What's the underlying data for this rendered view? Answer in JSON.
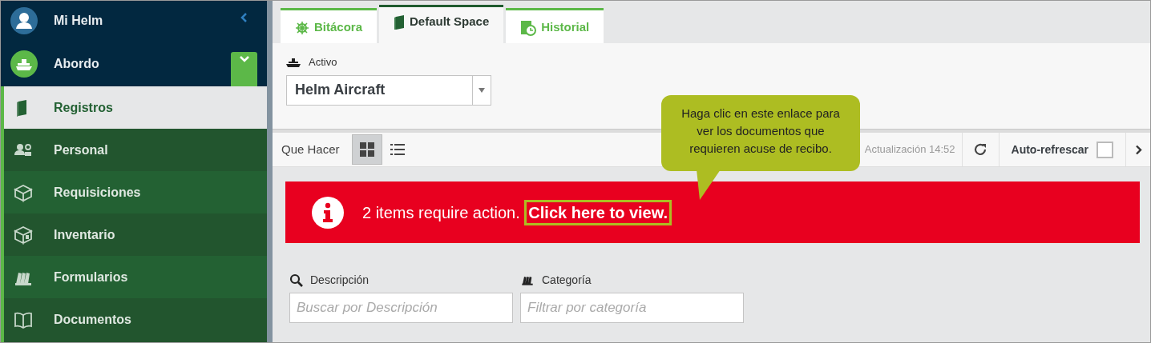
{
  "sidebar": {
    "user": {
      "label": "Mi Helm"
    },
    "section": {
      "label": "Abordo",
      "expanded": true
    },
    "items": [
      {
        "label": "Registros",
        "selected": true
      },
      {
        "label": "Personal",
        "selected": false
      },
      {
        "label": "Requisiciones",
        "selected": false
      },
      {
        "label": "Inventario",
        "selected": false
      },
      {
        "label": "Formularios",
        "selected": false
      },
      {
        "label": "Documentos",
        "selected": false
      }
    ]
  },
  "tabs": [
    {
      "label": "Bitácora",
      "selected": false
    },
    {
      "label": "Default Space",
      "selected": true
    },
    {
      "label": "Historial",
      "selected": false
    }
  ],
  "asset": {
    "label": "Activo",
    "value": "Helm Aircraft"
  },
  "toolbar": {
    "title": "Que Hacer",
    "views": [
      {
        "kind": "grid",
        "selected": true
      },
      {
        "kind": "list",
        "selected": false
      }
    ],
    "updated": "Actualización 14:52",
    "auto_refresh": {
      "label": "Auto-refrescar",
      "checked": false
    }
  },
  "alert": {
    "message": "2 items require action.",
    "link": "Click here to view."
  },
  "filters": [
    {
      "label": "Descripción",
      "placeholder": "Buscar por Descripción"
    },
    {
      "label": "Categoría",
      "placeholder": "Filtrar por categoría"
    }
  ],
  "callout": {
    "text": "Haga clic en este enlace para ver los documentos que requieren acuse de recibo."
  }
}
